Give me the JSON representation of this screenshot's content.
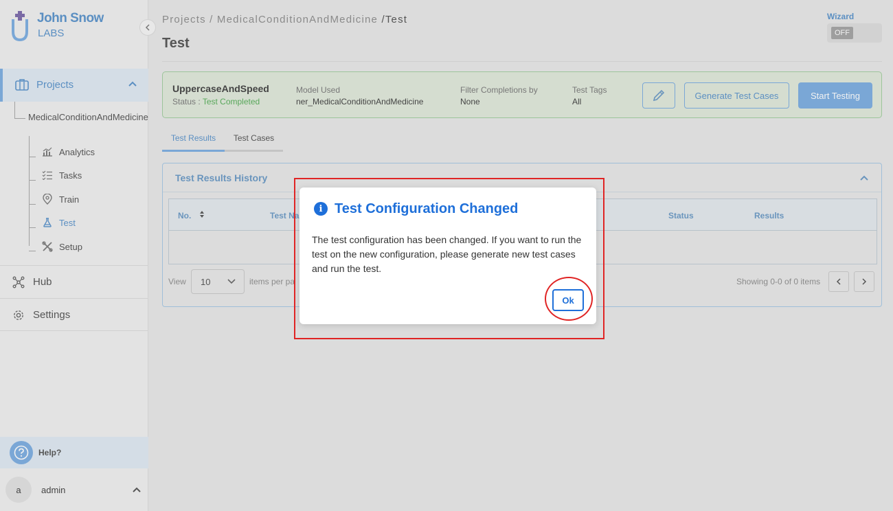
{
  "brand": {
    "name": "John Snow",
    "sub": "LABS"
  },
  "sidebar": {
    "projects_label": "Projects",
    "project_name": "MedicalConditionAndMedicine",
    "sub_items": [
      {
        "label": "Analytics",
        "icon": "analytics-icon"
      },
      {
        "label": "Tasks",
        "icon": "tasks-icon"
      },
      {
        "label": "Train",
        "icon": "train-icon"
      },
      {
        "label": "Test",
        "icon": "flask-icon",
        "active": true
      },
      {
        "label": "Setup",
        "icon": "setup-icon"
      }
    ],
    "hub_label": "Hub",
    "settings_label": "Settings",
    "help_label": "Help?",
    "user_initial": "a",
    "user_name": "admin"
  },
  "breadcrumb": {
    "projects": "Projects",
    "sep": "/",
    "project": "MedicalConditionAndMedicine",
    "current": "Test"
  },
  "page_title": "Test",
  "wizard": {
    "label": "Wizard",
    "state": "OFF"
  },
  "test_card": {
    "name": "UppercaseAndSpeed",
    "status_label": "Status : ",
    "status_value": "Test Completed",
    "model_used_label": "Model Used",
    "model_used_value": "ner_MedicalConditionAndMedicine",
    "filter_label": "Filter Completions by",
    "filter_value": "None",
    "tags_label": "Test Tags",
    "tags_value": "All",
    "generate_label": "Generate Test Cases",
    "start_label": "Start Testing"
  },
  "tabs": [
    {
      "label": "Test Results",
      "active": true
    },
    {
      "label": "Test Cases",
      "active": false
    }
  ],
  "history": {
    "title": "Test Results History",
    "columns": {
      "no": "No.",
      "test_name": "Test Na",
      "status": "Status",
      "results": "Results"
    },
    "view_label": "View",
    "page_size": "10",
    "items_per_page": "items per pa",
    "showing": "Showing 0-0 of 0 items"
  },
  "modal": {
    "title": "Test Configuration Changed",
    "body": "The test configuration has been changed. If you want to run the test on the new configuration, please generate new test cases and run the test.",
    "ok_label": "Ok"
  },
  "colors": {
    "accent": "#1e6fd9",
    "sidebar_accent": "#7aa7d6",
    "success": "#58a75a",
    "annotation": "#e02424"
  }
}
